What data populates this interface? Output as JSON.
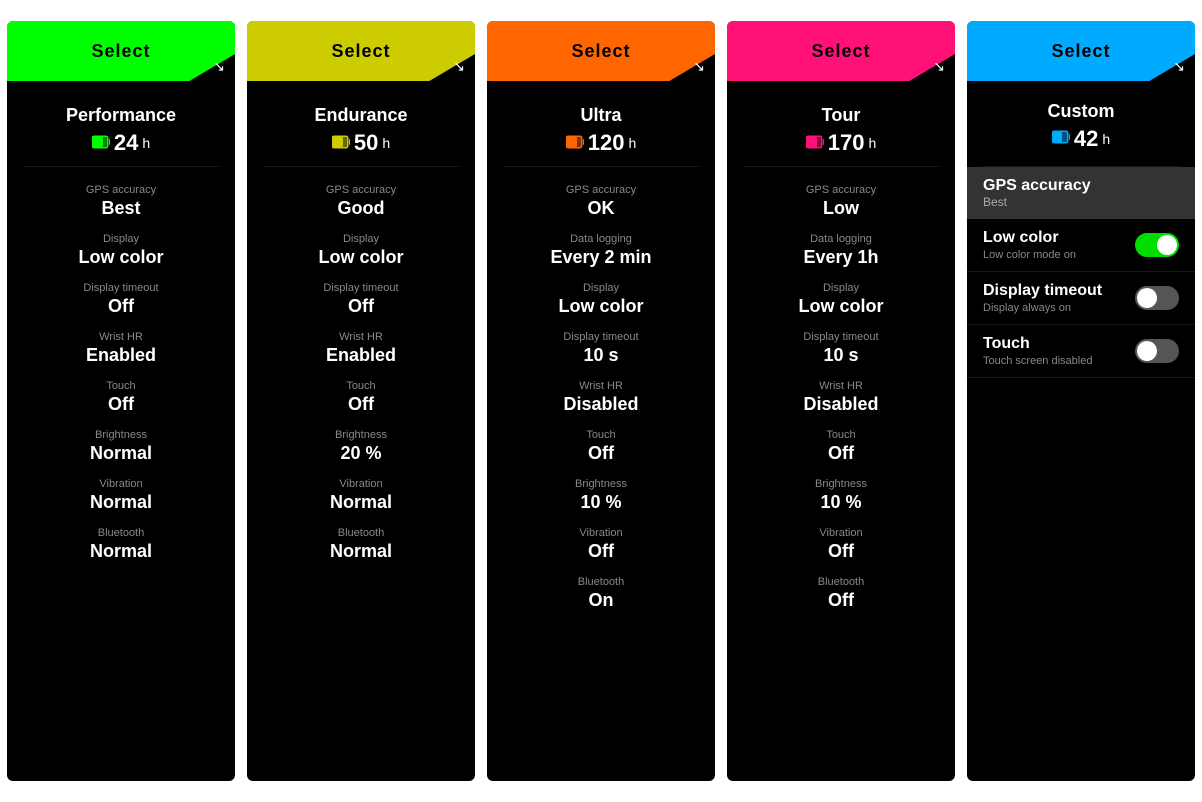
{
  "cards": [
    {
      "id": "performance",
      "header_color": "#00ff00",
      "header_label": "Select",
      "profile_name": "Performance",
      "battery_color": "#00ff00",
      "battery_icon": "🔋",
      "battery_value": "24",
      "battery_unit": "h",
      "stats": [
        {
          "label": "GPS accuracy",
          "value": "Best"
        },
        {
          "label": "Display",
          "value": "Low color"
        },
        {
          "label": "Display timeout",
          "value": "Off"
        },
        {
          "label": "Wrist HR",
          "value": "Enabled"
        },
        {
          "label": "Touch",
          "value": "Off"
        },
        {
          "label": "Brightness",
          "value": "Normal"
        },
        {
          "label": "Vibration",
          "value": "Normal"
        },
        {
          "label": "Bluetooth",
          "value": "Normal"
        }
      ]
    },
    {
      "id": "endurance",
      "header_color": "#cccc00",
      "header_label": "Select",
      "profile_name": "Endurance",
      "battery_color": "#cccc00",
      "battery_icon": "🔋",
      "battery_value": "50",
      "battery_unit": "h",
      "stats": [
        {
          "label": "GPS accuracy",
          "value": "Good"
        },
        {
          "label": "Display",
          "value": "Low color"
        },
        {
          "label": "Display timeout",
          "value": "Off"
        },
        {
          "label": "Wrist HR",
          "value": "Enabled"
        },
        {
          "label": "Touch",
          "value": "Off"
        },
        {
          "label": "Brightness",
          "value": "20 %"
        },
        {
          "label": "Vibration",
          "value": "Normal"
        },
        {
          "label": "Bluetooth",
          "value": "Normal"
        }
      ]
    },
    {
      "id": "ultra",
      "header_color": "#ff6600",
      "header_label": "Select",
      "profile_name": "Ultra",
      "battery_color": "#ff6600",
      "battery_icon": "🔋",
      "battery_value": "120",
      "battery_unit": "h",
      "stats": [
        {
          "label": "GPS accuracy",
          "value": "OK"
        },
        {
          "label": "Data logging",
          "value": "Every 2 min"
        },
        {
          "label": "Display",
          "value": "Low color"
        },
        {
          "label": "Display timeout",
          "value": "10 s"
        },
        {
          "label": "Wrist HR",
          "value": "Disabled"
        },
        {
          "label": "Touch",
          "value": "Off"
        },
        {
          "label": "Brightness",
          "value": "10 %"
        },
        {
          "label": "Vibration",
          "value": "Off"
        },
        {
          "label": "Bluetooth",
          "value": "On"
        }
      ]
    },
    {
      "id": "tour",
      "header_color": "#ff1177",
      "header_label": "Select",
      "profile_name": "Tour",
      "battery_color": "#ff1177",
      "battery_icon": "🔋",
      "battery_value": "170",
      "battery_unit": "h",
      "stats": [
        {
          "label": "GPS accuracy",
          "value": "Low"
        },
        {
          "label": "Data logging",
          "value": "Every 1h"
        },
        {
          "label": "Display",
          "value": "Low color"
        },
        {
          "label": "Display timeout",
          "value": "10 s"
        },
        {
          "label": "Wrist HR",
          "value": "Disabled"
        },
        {
          "label": "Touch",
          "value": "Off"
        },
        {
          "label": "Brightness",
          "value": "10 %"
        },
        {
          "label": "Vibration",
          "value": "Off"
        },
        {
          "label": "Bluetooth",
          "value": "Off"
        }
      ]
    }
  ],
  "custom_card": {
    "header_color": "#00aaff",
    "header_label": "Select",
    "profile_name": "Custom",
    "battery_value": "42",
    "battery_unit": "h",
    "gps_label": "GPS accuracy",
    "gps_value": "Best",
    "settings": [
      {
        "label": "Low color",
        "sub": "Low color mode on",
        "toggle": "on"
      },
      {
        "label": "Display timeout",
        "sub": "Display always on",
        "toggle": "off"
      },
      {
        "label": "Touch",
        "sub": "Touch screen disabled",
        "toggle": "off"
      }
    ]
  },
  "arrow": "↙"
}
